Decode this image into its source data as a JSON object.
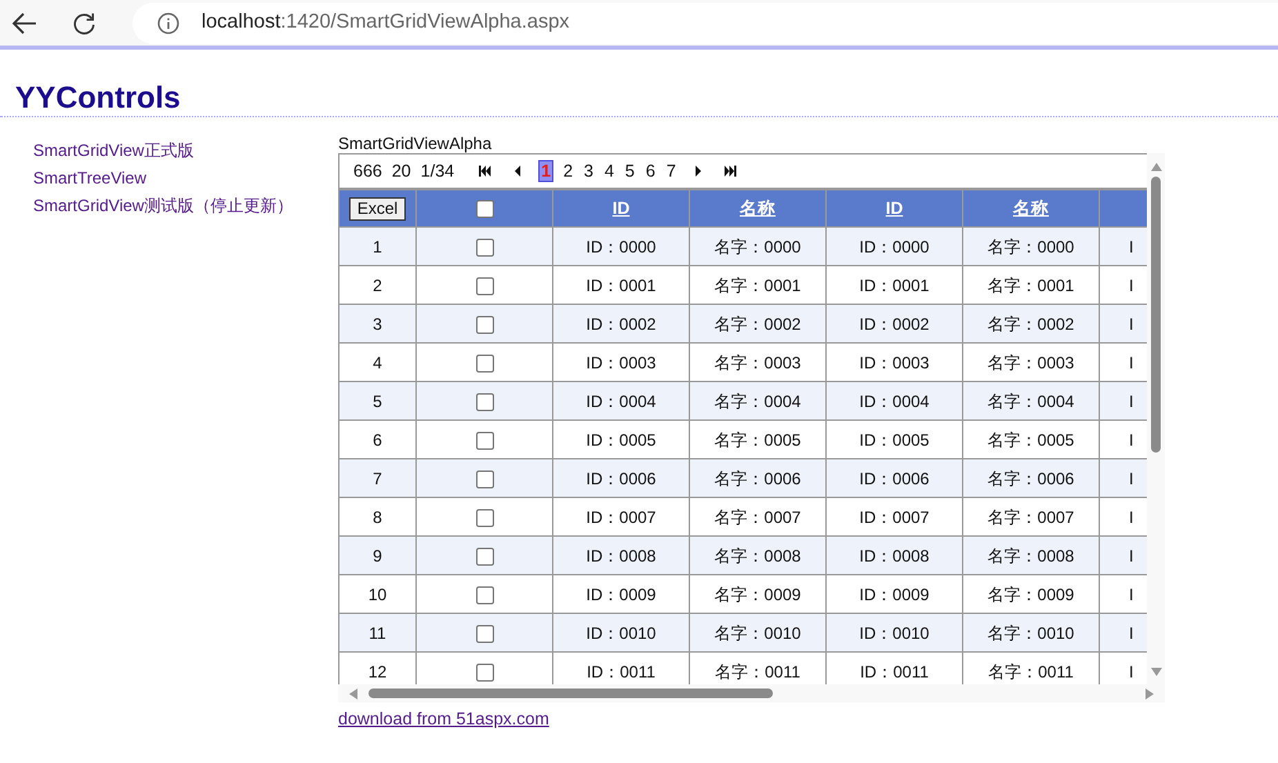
{
  "browser": {
    "url_host": "localhost",
    "url_path": ":1420/SmartGridViewAlpha.aspx"
  },
  "site_title": "YYControls",
  "sidebar": {
    "items": [
      {
        "label": "SmartGridView正式版"
      },
      {
        "label": "SmartTreeView"
      },
      {
        "label": "SmartGridView测试版（停止更新）"
      }
    ]
  },
  "grid": {
    "caption": "SmartGridViewAlpha",
    "pager": {
      "record_count": "666",
      "page_size": "20",
      "page_info": "1/34",
      "pages": [
        {
          "label": "1",
          "selected": true
        },
        {
          "label": "2",
          "selected": false
        },
        {
          "label": "3",
          "selected": false
        },
        {
          "label": "4",
          "selected": false
        },
        {
          "label": "5",
          "selected": false
        },
        {
          "label": "6",
          "selected": false
        },
        {
          "label": "7",
          "selected": false
        }
      ]
    },
    "excel_button": "Excel",
    "header_checkbox": {
      "checked": false
    },
    "columns": [
      "ID",
      "名称",
      "ID",
      "名称"
    ],
    "rows": [
      {
        "number": "1",
        "checked": false,
        "cells": [
          "ID：0000",
          "名字：0000",
          "ID：0000",
          "名字：0000",
          "I"
        ]
      },
      {
        "number": "2",
        "checked": false,
        "cells": [
          "ID：0001",
          "名字：0001",
          "ID：0001",
          "名字：0001",
          "I"
        ]
      },
      {
        "number": "3",
        "checked": false,
        "cells": [
          "ID：0002",
          "名字：0002",
          "ID：0002",
          "名字：0002",
          "I"
        ]
      },
      {
        "number": "4",
        "checked": false,
        "cells": [
          "ID：0003",
          "名字：0003",
          "ID：0003",
          "名字：0003",
          "I"
        ]
      },
      {
        "number": "5",
        "checked": false,
        "cells": [
          "ID：0004",
          "名字：0004",
          "ID：0004",
          "名字：0004",
          "I"
        ]
      },
      {
        "number": "6",
        "checked": false,
        "cells": [
          "ID：0005",
          "名字：0005",
          "ID：0005",
          "名字：0005",
          "I"
        ]
      },
      {
        "number": "7",
        "checked": false,
        "cells": [
          "ID：0006",
          "名字：0006",
          "ID：0006",
          "名字：0006",
          "I"
        ]
      },
      {
        "number": "8",
        "checked": false,
        "cells": [
          "ID：0007",
          "名字：0007",
          "ID：0007",
          "名字：0007",
          "I"
        ]
      },
      {
        "number": "9",
        "checked": false,
        "cells": [
          "ID：0008",
          "名字：0008",
          "ID：0008",
          "名字：0008",
          "I"
        ]
      },
      {
        "number": "10",
        "checked": false,
        "cells": [
          "ID：0009",
          "名字：0009",
          "ID：0009",
          "名字：0009",
          "I"
        ]
      },
      {
        "number": "11",
        "checked": false,
        "cells": [
          "ID：0010",
          "名字：0010",
          "ID：0010",
          "名字：0010",
          "I"
        ]
      },
      {
        "number": "12",
        "checked": false,
        "cells": [
          "ID：0011",
          "名字：0011",
          "ID：0011",
          "名字：0011",
          "I"
        ]
      }
    ]
  },
  "footer_link": "download from 51aspx.com"
}
